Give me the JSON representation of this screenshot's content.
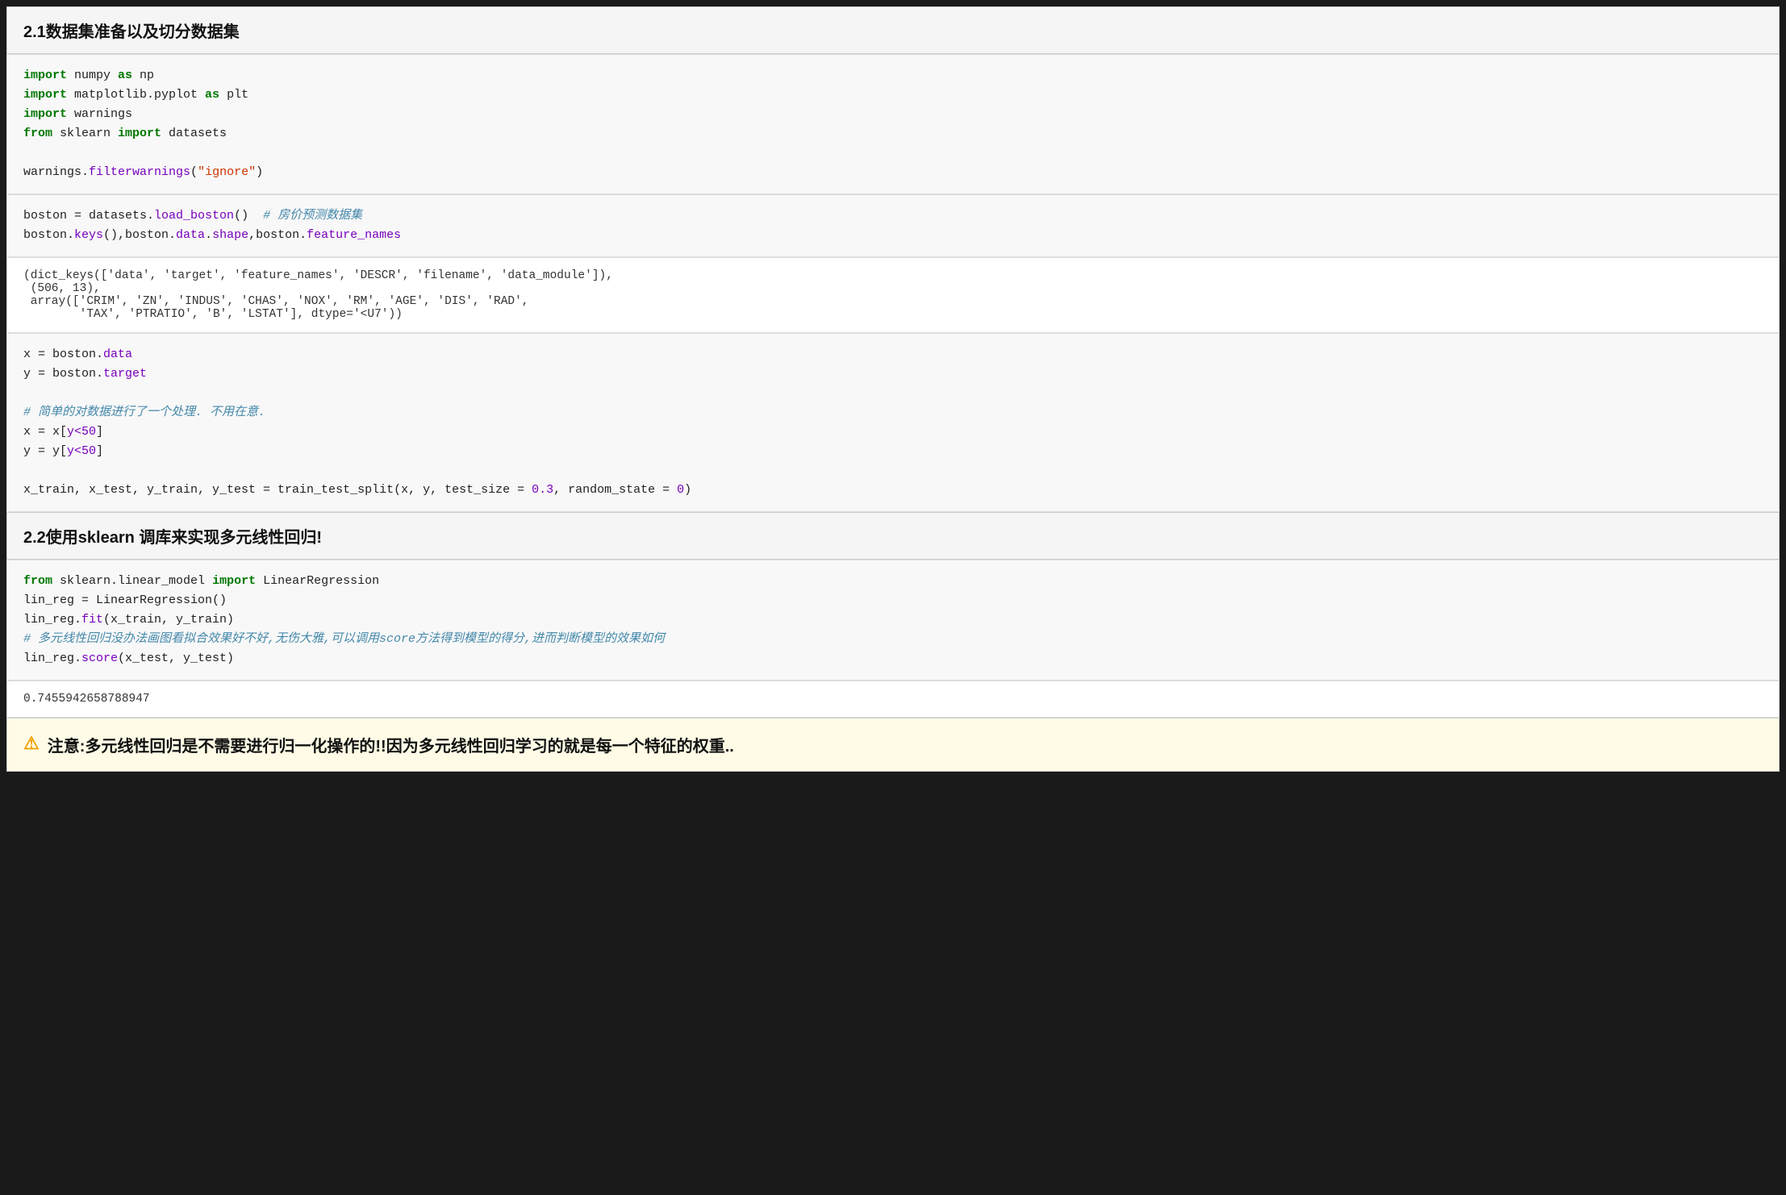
{
  "section1": {
    "title": "2.1数据集准备以及切分数据集"
  },
  "section2": {
    "title": "2.2使用sklearn 调库来实现多元线性回归!"
  },
  "code_block1": {
    "lines": [
      {
        "parts": [
          {
            "text": "import",
            "cls": "kw"
          },
          {
            "text": " numpy ",
            "cls": "plain"
          },
          {
            "text": "as",
            "cls": "kw"
          },
          {
            "text": " np",
            "cls": "plain"
          }
        ]
      },
      {
        "parts": [
          {
            "text": "import",
            "cls": "kw"
          },
          {
            "text": " matplotlib.pyplot ",
            "cls": "plain"
          },
          {
            "text": "as",
            "cls": "kw"
          },
          {
            "text": " plt",
            "cls": "plain"
          }
        ]
      },
      {
        "parts": [
          {
            "text": "import",
            "cls": "kw"
          },
          {
            "text": " warnings",
            "cls": "plain"
          }
        ]
      },
      {
        "parts": [
          {
            "text": "from",
            "cls": "kw"
          },
          {
            "text": " sklearn ",
            "cls": "plain"
          },
          {
            "text": "import",
            "cls": "kw"
          },
          {
            "text": " datasets",
            "cls": "plain"
          }
        ]
      },
      {
        "parts": []
      },
      {
        "parts": [
          {
            "text": "warnings.",
            "cls": "plain"
          },
          {
            "text": "filterwarnings",
            "cls": "func"
          },
          {
            "text": "(",
            "cls": "plain"
          },
          {
            "text": "\"ignore\"",
            "cls": "str"
          },
          {
            "text": ")",
            "cls": "plain"
          }
        ]
      }
    ]
  },
  "code_block2": {
    "lines": [
      {
        "parts": [
          {
            "text": "boston = datasets.",
            "cls": "plain"
          },
          {
            "text": "load_boston",
            "cls": "func"
          },
          {
            "text": "()  ",
            "cls": "plain"
          },
          {
            "text": "# 房价预测数据集",
            "cls": "comment"
          }
        ]
      },
      {
        "parts": [
          {
            "text": "boston.",
            "cls": "plain"
          },
          {
            "text": "keys",
            "cls": "func"
          },
          {
            "text": "(),boston.",
            "cls": "plain"
          },
          {
            "text": "data",
            "cls": "attr"
          },
          {
            "text": ".",
            "cls": "plain"
          },
          {
            "text": "shape",
            "cls": "attr"
          },
          {
            "text": ",boston.",
            "cls": "plain"
          },
          {
            "text": "feature_names",
            "cls": "attr"
          }
        ]
      }
    ]
  },
  "output_block1": {
    "text": "(dict_keys(['data', 'target', 'feature_names', 'DESCR', 'filename', 'data_module']),\n (506, 13),\n array(['CRIM', 'ZN', 'INDUS', 'CHAS', 'NOX', 'RM', 'AGE', 'DIS', 'RAD',\n        'TAX', 'PTRATIO', 'B', 'LSTAT'], dtype='<U7'))"
  },
  "code_block3": {
    "lines": [
      {
        "parts": [
          {
            "text": "x = boston.",
            "cls": "plain"
          },
          {
            "text": "data",
            "cls": "attr"
          }
        ]
      },
      {
        "parts": [
          {
            "text": "y = boston.",
            "cls": "plain"
          },
          {
            "text": "target",
            "cls": "attr"
          }
        ]
      },
      {
        "parts": []
      },
      {
        "parts": [
          {
            "text": "# 简单的对数据进行了一个处理. 不用在意.",
            "cls": "comment"
          }
        ]
      },
      {
        "parts": [
          {
            "text": "x = x[",
            "cls": "plain"
          },
          {
            "text": "y<50",
            "cls": "attr"
          },
          {
            "text": "]",
            "cls": "plain"
          }
        ]
      },
      {
        "parts": [
          {
            "text": "y = y[",
            "cls": "plain"
          },
          {
            "text": "y<50",
            "cls": "attr"
          },
          {
            "text": "]",
            "cls": "plain"
          }
        ]
      },
      {
        "parts": []
      },
      {
        "parts": [
          {
            "text": "x_train, x_test, y_train, y_test = train_test_split(x, y, test_size = ",
            "cls": "plain"
          },
          {
            "text": "0.3",
            "cls": "num"
          },
          {
            "text": ", random_state = ",
            "cls": "plain"
          },
          {
            "text": "0",
            "cls": "num"
          },
          {
            "text": ")",
            "cls": "plain"
          }
        ]
      }
    ]
  },
  "code_block4": {
    "lines": [
      {
        "parts": [
          {
            "text": "from",
            "cls": "kw"
          },
          {
            "text": " sklearn.linear_model ",
            "cls": "plain"
          },
          {
            "text": "import",
            "cls": "kw"
          },
          {
            "text": " LinearRegression",
            "cls": "plain"
          }
        ]
      },
      {
        "parts": [
          {
            "text": "lin_reg = LinearRegression()",
            "cls": "plain"
          }
        ]
      },
      {
        "parts": [
          {
            "text": "lin_reg.",
            "cls": "plain"
          },
          {
            "text": "fit",
            "cls": "func"
          },
          {
            "text": "(x_train, y_train)",
            "cls": "plain"
          }
        ]
      },
      {
        "parts": [
          {
            "text": "# 多元线性回归没办法画图看拟合效果好不好,无伤大雅,可以调用score方法得到模型的得分,进而判断模型的效果如何",
            "cls": "comment"
          }
        ]
      },
      {
        "parts": [
          {
            "text": "lin_reg.",
            "cls": "plain"
          },
          {
            "text": "score",
            "cls": "func"
          },
          {
            "text": "(x_test, y_test)",
            "cls": "plain"
          }
        ]
      }
    ]
  },
  "output_block2": {
    "text": "0.7455942658788947"
  },
  "warning": {
    "icon": "⚠",
    "text": "注意:多元线性回归是不需要进行归一化操作的!!因为多元线性回归学习的就是每一个特征的权重.."
  }
}
